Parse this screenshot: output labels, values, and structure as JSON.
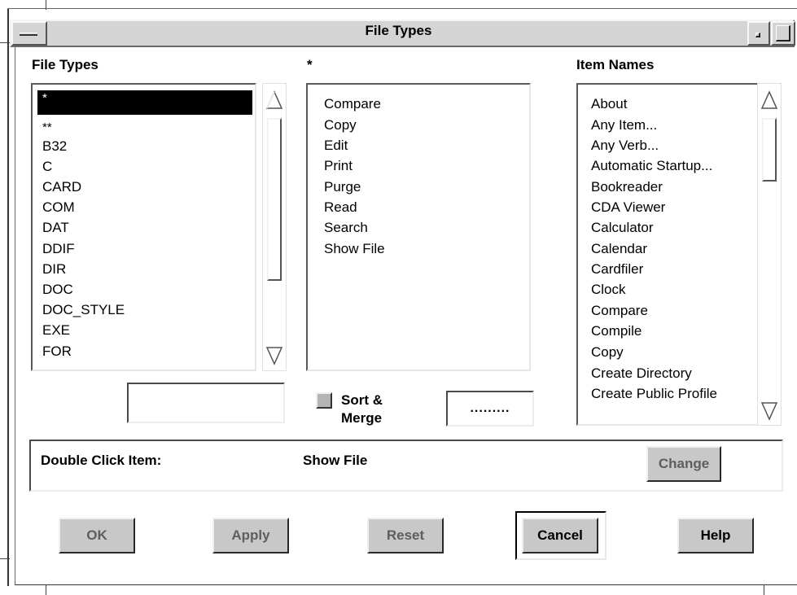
{
  "window": {
    "title": "File Types"
  },
  "file_types": {
    "header": "File Types",
    "items": [
      "*",
      "**",
      "B32",
      "C",
      "CARD",
      "COM",
      "DAT",
      "DDIF",
      "DIR",
      "DOC",
      "DOC_STYLE",
      "EXE",
      "FOR"
    ],
    "selected": "*",
    "field_value": ""
  },
  "verbs": {
    "header": "*",
    "items": [
      "Compare",
      "Copy",
      "Edit",
      "Print",
      "Purge",
      "Read",
      "Search",
      "Show File"
    ],
    "sort_merge_label_1": "Sort &",
    "sort_merge_label_2": "Merge",
    "field_value": "........."
  },
  "item_names": {
    "header": "Item Names",
    "items": [
      "About",
      "Any Item...",
      "Any Verb...",
      "Automatic Startup...",
      "Bookreader",
      "CDA Viewer",
      "Calculator",
      "Calendar",
      "Cardfiler",
      "Clock",
      "Compare",
      "Compile",
      "Copy",
      "Create Directory",
      "Create Public Profile"
    ]
  },
  "double_click": {
    "label": "Double Click Item:",
    "value": "Show File",
    "change_label": "Change"
  },
  "buttons": {
    "ok": "OK",
    "apply": "Apply",
    "reset": "Reset",
    "cancel": "Cancel",
    "help": "Help"
  },
  "icons": {
    "window_menu": "minus-icon",
    "minimize": "minimize-icon",
    "maximize": "maximize-icon",
    "scroll_up": "triangle-up-icon",
    "scroll_down": "triangle-down-icon"
  }
}
